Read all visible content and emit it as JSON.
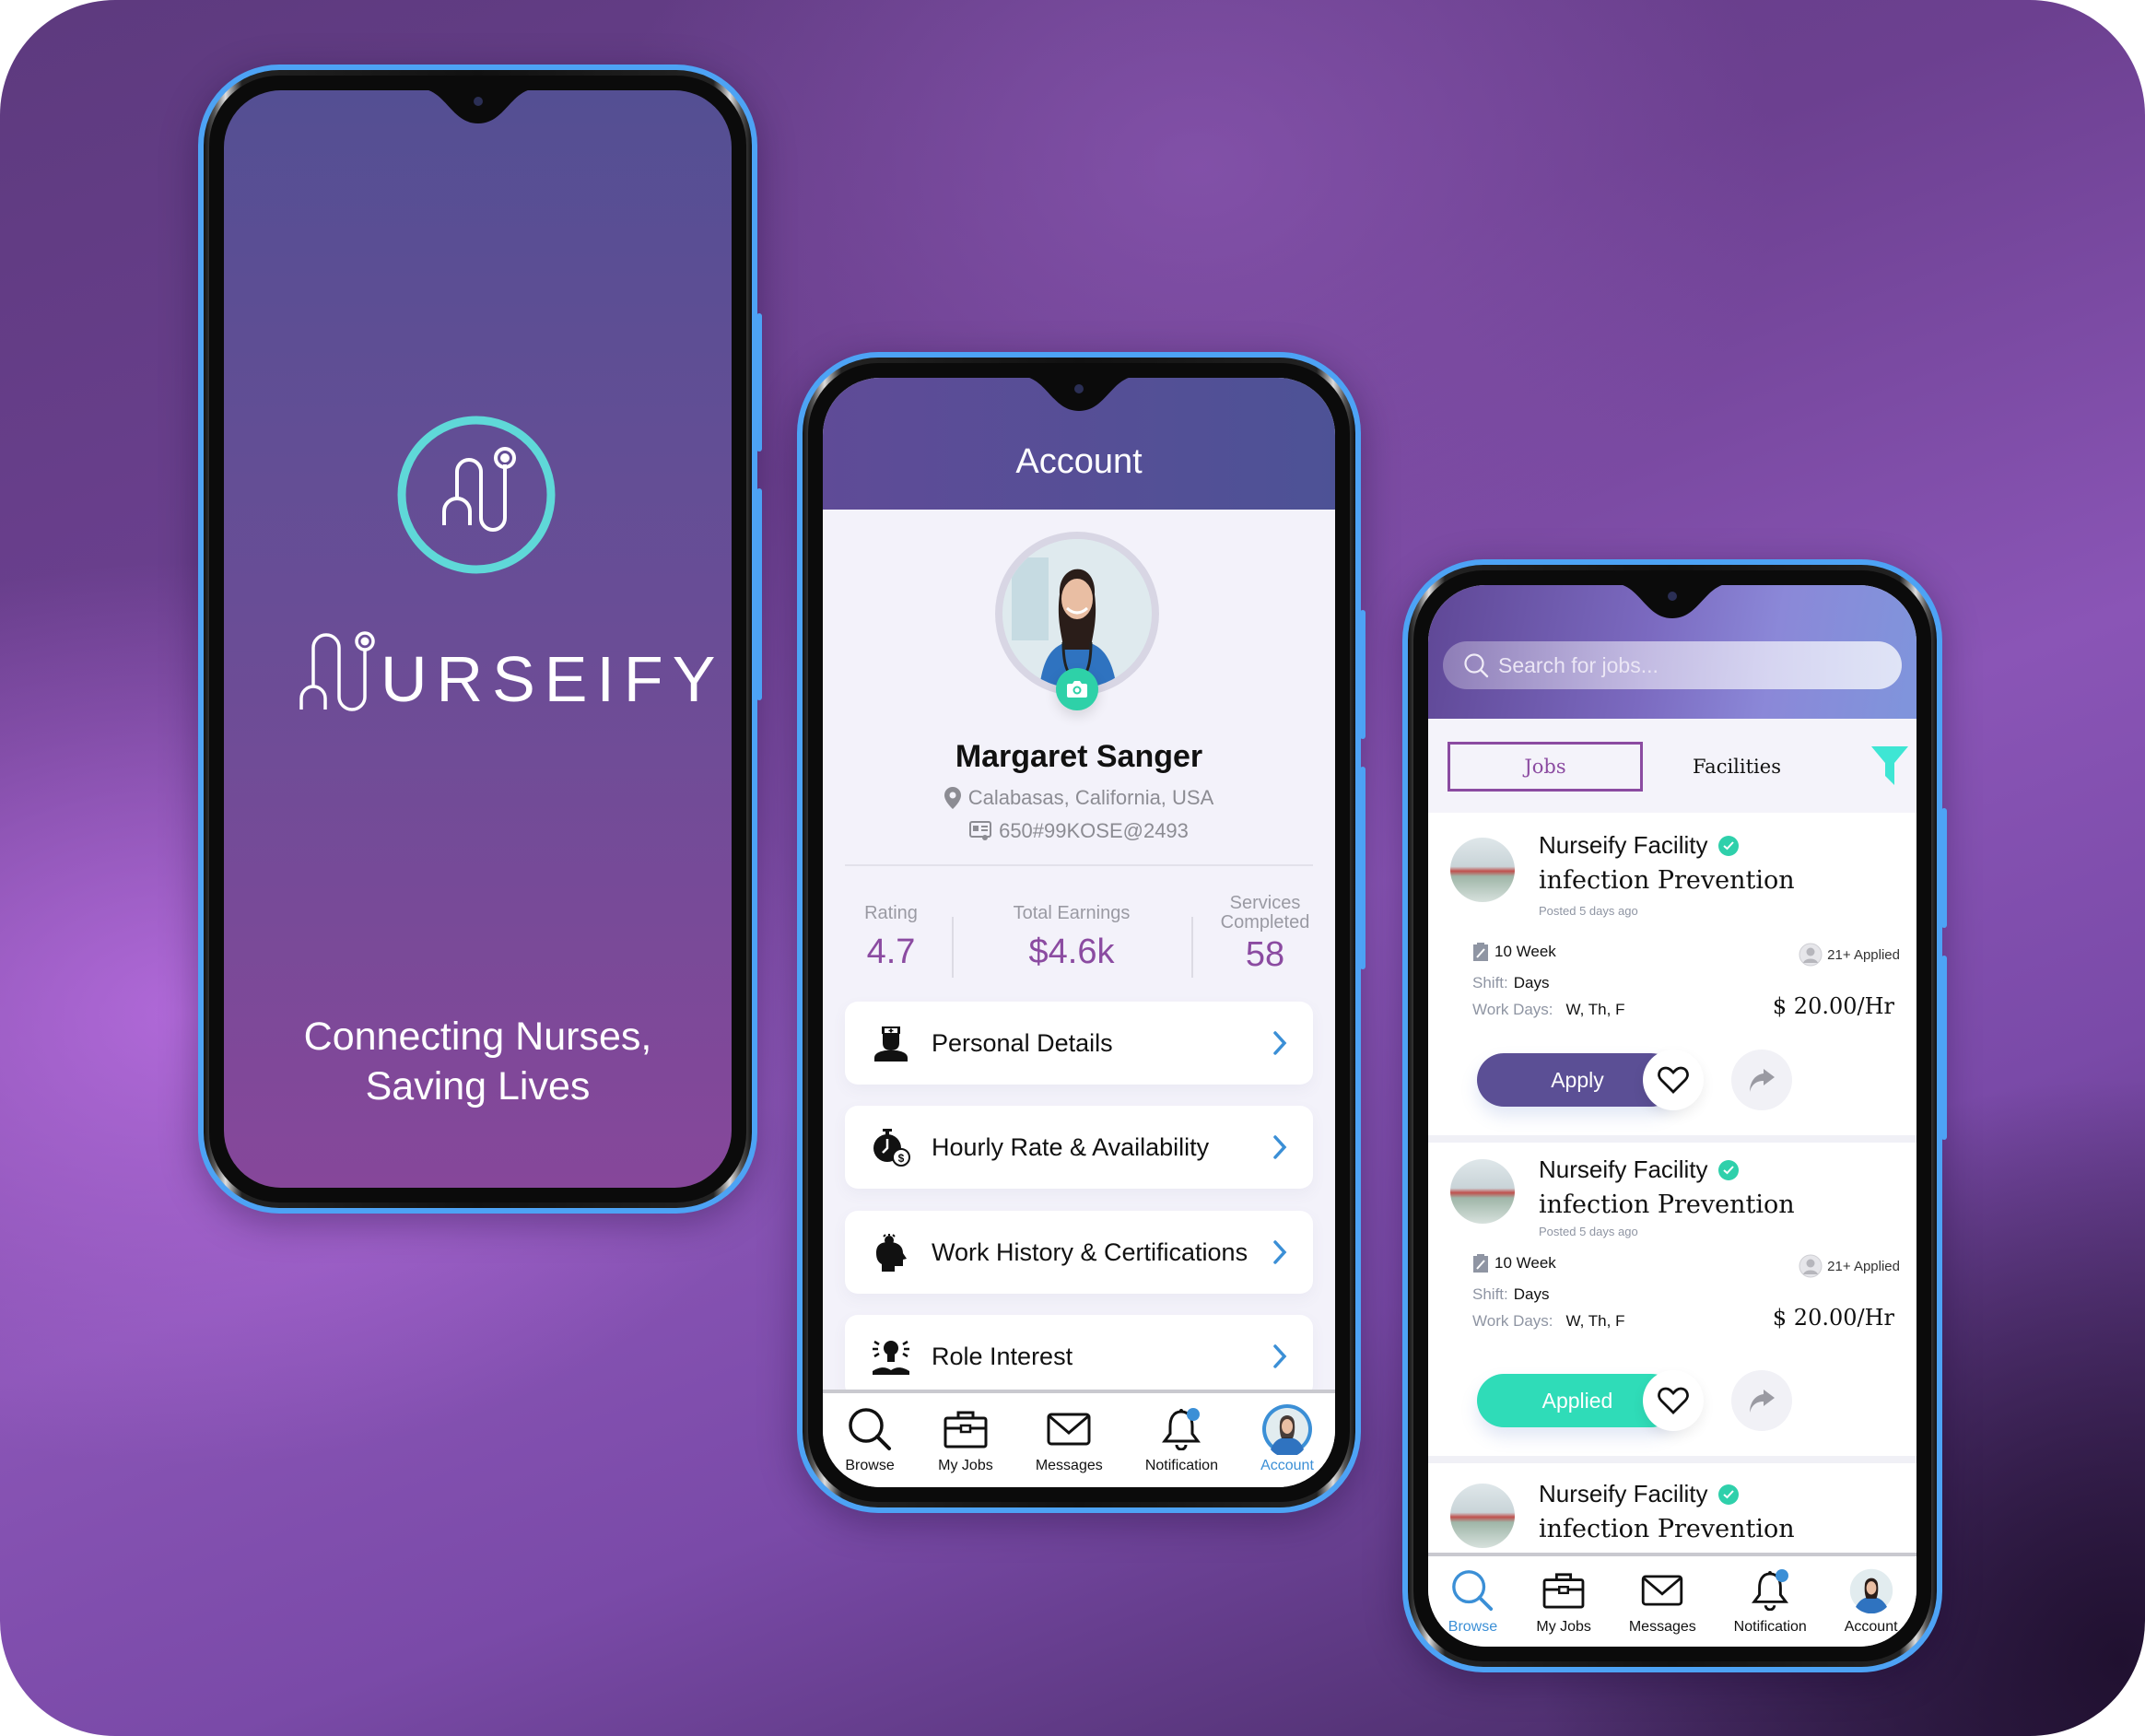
{
  "colors": {
    "accent_purple": "#8b4ba1",
    "header_purple": "#5f4b97",
    "teal": "#2ed1a8",
    "link_blue": "#3b8fd6",
    "apply_button": "#5b4f95",
    "phone_frame": "#4da3f5"
  },
  "splash": {
    "brand_name": "URSEIFY",
    "logo_icon": "stethoscope-icon",
    "tagline_line1": "Connecting Nurses,",
    "tagline_line2": "Saving Lives"
  },
  "account": {
    "title": "Account",
    "profile": {
      "name": "Margaret Sanger",
      "location": "Calabasas, California, USA",
      "license_id": "650#99KOSE@2493"
    },
    "stats": [
      {
        "label": "Rating",
        "value": "4.7"
      },
      {
        "label": "Total Earnings",
        "value": "$4.6k"
      },
      {
        "label_line1": "Services",
        "label_line2": "Completed",
        "value": "58"
      }
    ],
    "menu": [
      {
        "label": "Personal Details",
        "icon": "nurse-icon"
      },
      {
        "label": "Hourly Rate & Availability",
        "icon": "stopwatch-dollar-icon"
      },
      {
        "label": "Work History & Certifications",
        "icon": "head-gear-icon"
      },
      {
        "label": "Role Interest",
        "icon": "lightbulb-book-icon"
      }
    ],
    "nav": [
      {
        "label": "Browse",
        "icon": "search-icon",
        "active": false
      },
      {
        "label": "My Jobs",
        "icon": "briefcase-icon",
        "active": false
      },
      {
        "label": "Messages",
        "icon": "mail-icon",
        "active": false
      },
      {
        "label": "Notification",
        "icon": "bell-icon",
        "active": false
      },
      {
        "label": "Account",
        "icon": "avatar-icon",
        "active": true
      }
    ]
  },
  "jobs": {
    "search_placeholder": "Search for jobs...",
    "tabs": [
      {
        "label": "Jobs",
        "active": true
      },
      {
        "label": "Facilities",
        "active": false
      }
    ],
    "listings": [
      {
        "facility": "Nurseify Facility",
        "job_title": "infection Prevention",
        "posted": "Posted 5 days ago",
        "duration": "10 Week",
        "applied": "21+ Applied",
        "shift_label": "Shift:",
        "shift": "Days",
        "work_days_label": "Work Days:",
        "work_days": "W, Th, F",
        "rate": "$ 20.00/Hr",
        "action": "Apply"
      },
      {
        "facility": "Nurseify Facility",
        "job_title": "infection Prevention",
        "posted": "Posted 5 days ago",
        "duration": "10 Week",
        "applied": "21+ Applied",
        "shift_label": "Shift:",
        "shift": "Days",
        "work_days_label": "Work Days:",
        "work_days": "W, Th, F",
        "rate": "$ 20.00/Hr",
        "action": "Applied"
      },
      {
        "facility": "Nurseify Facility",
        "job_title": "infection Prevention"
      }
    ],
    "nav": [
      {
        "label": "Browse",
        "icon": "search-icon",
        "active": true
      },
      {
        "label": "My Jobs",
        "icon": "briefcase-icon",
        "active": false
      },
      {
        "label": "Messages",
        "icon": "mail-icon",
        "active": false
      },
      {
        "label": "Notification",
        "icon": "bell-icon",
        "active": false
      },
      {
        "label": "Account",
        "icon": "avatar-icon",
        "active": false
      }
    ]
  }
}
